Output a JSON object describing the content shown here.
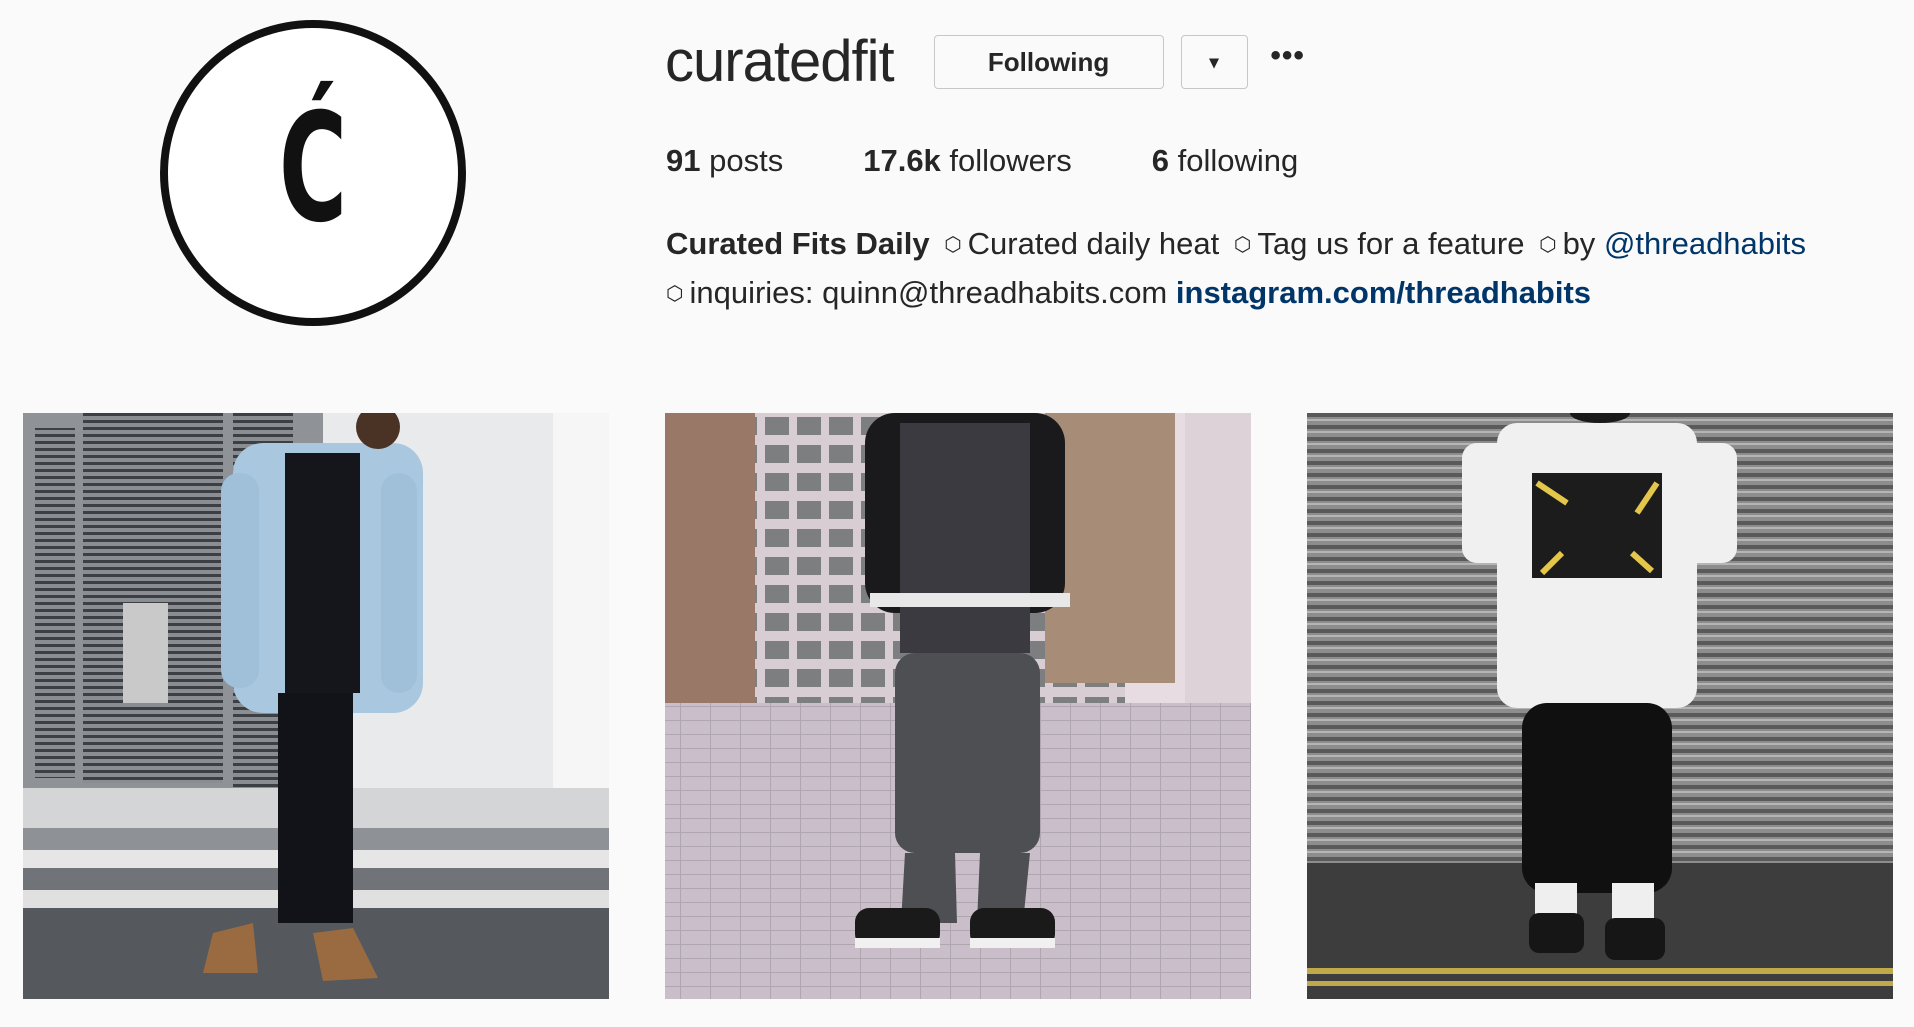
{
  "profile": {
    "avatar_letter": "Ć",
    "username": "curatedfit",
    "following_label": "Following",
    "dropdown_glyph": "▾",
    "more_glyph": "•••"
  },
  "stats": {
    "posts_count": "91",
    "posts_label": "posts",
    "followers_count": "17.6k",
    "followers_label": "followers",
    "following_count": "6",
    "following_label": "following"
  },
  "bio": {
    "name": "Curated Fits Daily",
    "separator": "⬡",
    "part1": "Curated daily heat",
    "part2": "Tag us for a feature",
    "part3": "by",
    "mention": "@threadhabits",
    "part4": "inquiries: quinn@threadhabits.com",
    "link": "instagram.com/threadhabits"
  },
  "colors": {
    "background": "#fafafa",
    "link": "#003569",
    "text": "#262626"
  },
  "icons": {
    "dropdown": "chevron-down-icon",
    "more": "more-options-icon"
  }
}
